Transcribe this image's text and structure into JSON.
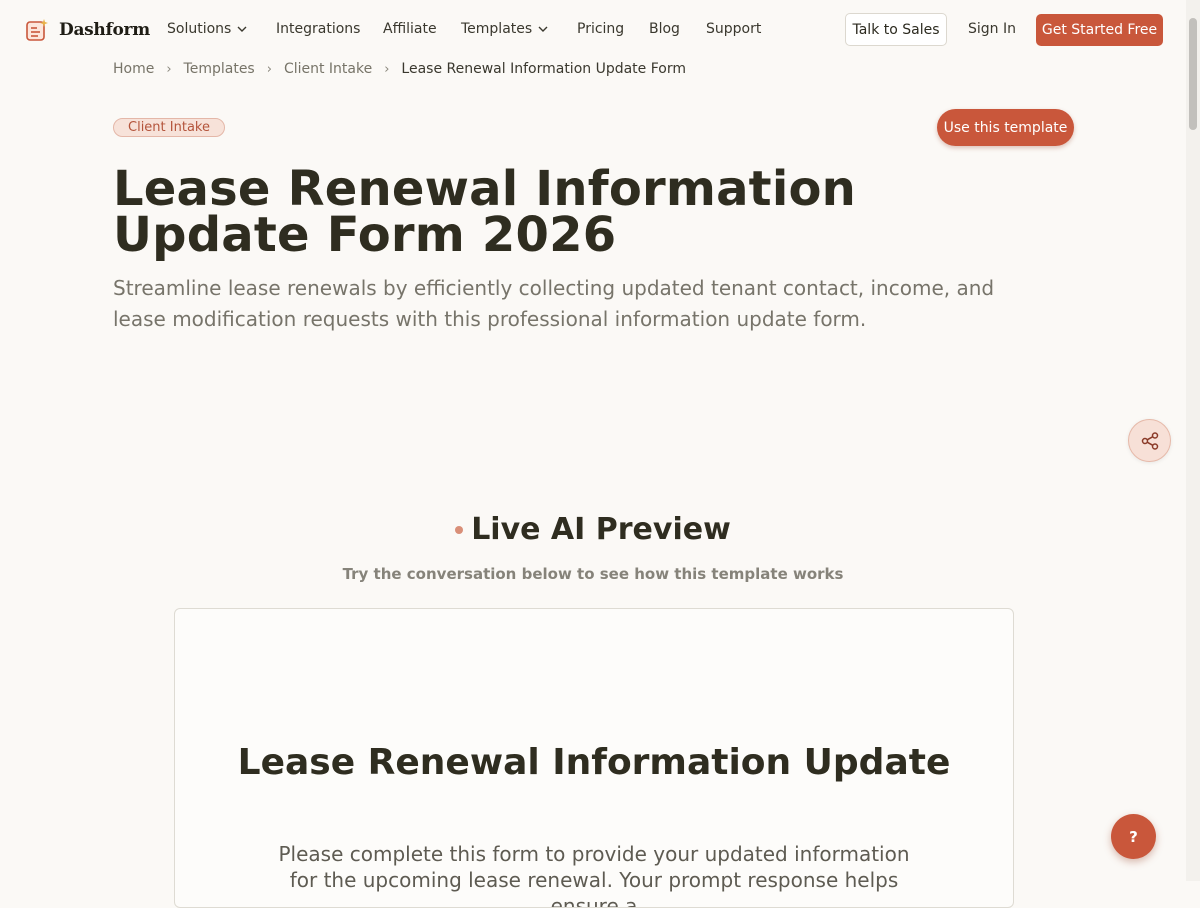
{
  "brand": {
    "name": "Dashform"
  },
  "nav": {
    "solutions": "Solutions",
    "integrations": "Integrations",
    "affiliate": "Affiliate",
    "templates": "Templates",
    "pricing": "Pricing",
    "blog": "Blog",
    "support": "Support",
    "talk_to_sales": "Talk to Sales",
    "sign_in": "Sign In",
    "get_started": "Get Started Free"
  },
  "breadcrumb": [
    "Home",
    "Templates",
    "Client Intake",
    "Lease Renewal Information Update Form"
  ],
  "badge": "Client Intake",
  "use_template": "Use this template",
  "title": "Lease Renewal Information Update Form 2026",
  "subtitle": "Streamline lease renewals by efficiently collecting updated tenant contact, income, and lease modification requests with this professional information update form.",
  "preview": {
    "heading": "Live AI Preview",
    "subheading": "Try the conversation below to see how this template works",
    "form_title": "Lease Renewal Information Update",
    "form_intro": "Please complete this form to provide your updated information for the upcoming lease renewal. Your prompt response helps ensure a"
  },
  "help_label": "?",
  "colors": {
    "accent": "#c9573b",
    "background": "#fbf9f6",
    "badge_bg": "#f7e2d9"
  }
}
